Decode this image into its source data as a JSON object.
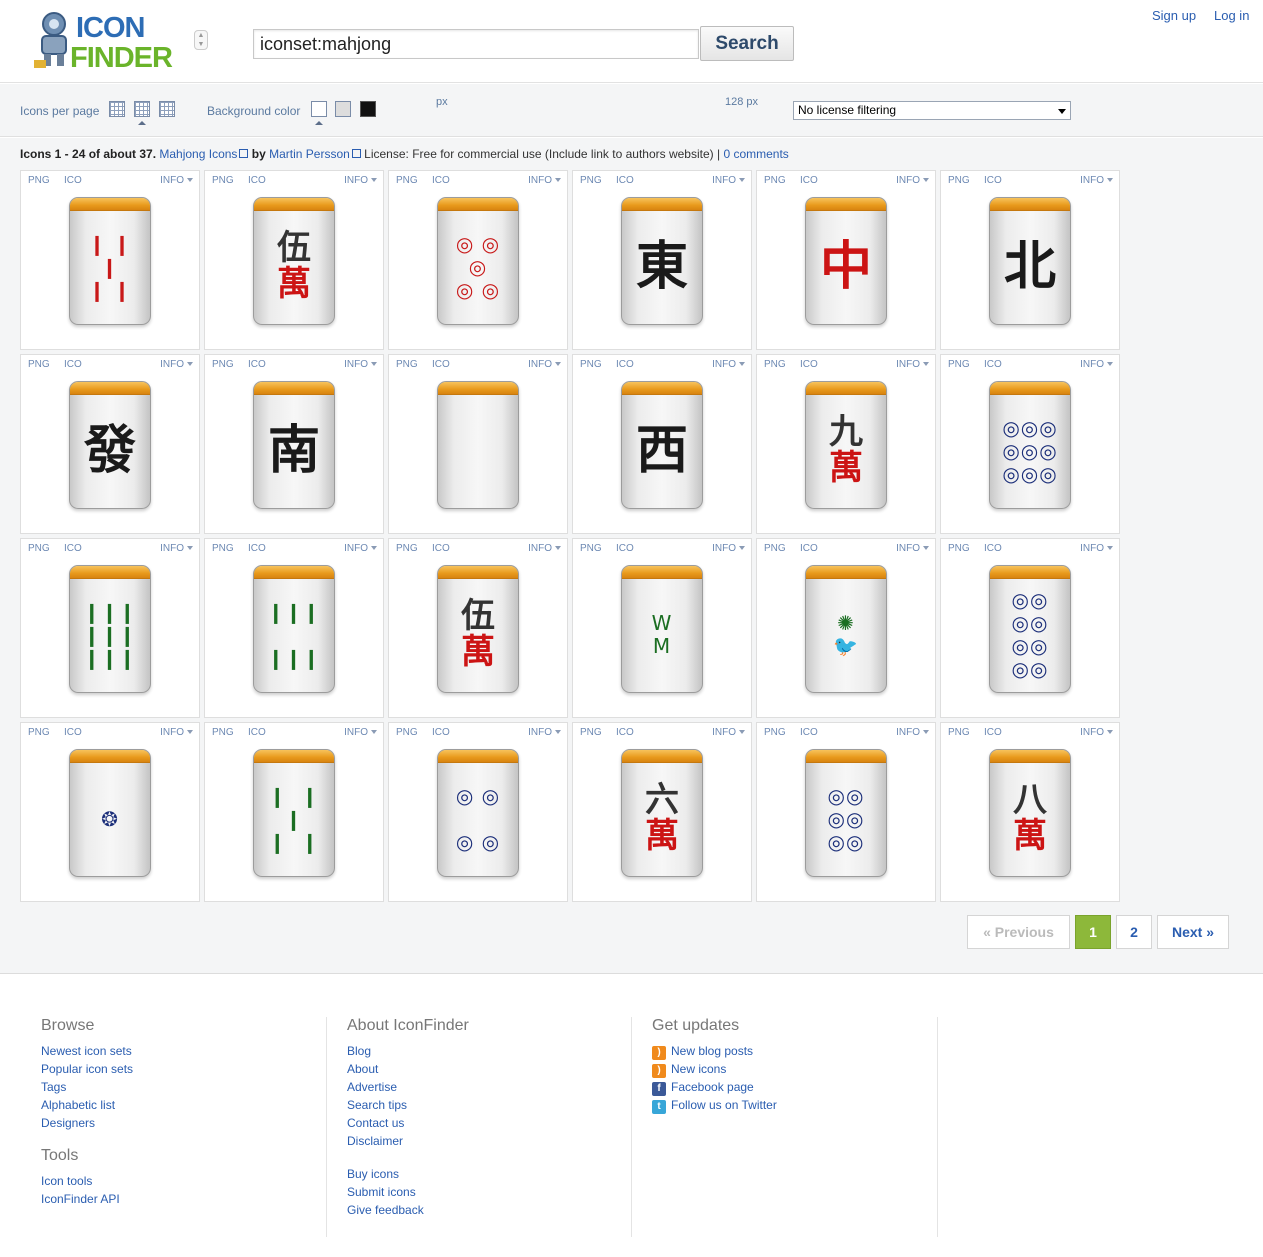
{
  "header": {
    "logo_top": "ICON",
    "logo_bottom": "FINDER",
    "search_value": "iconset:mahjong",
    "search_button": "Search",
    "signup": "Sign up",
    "login": "Log in"
  },
  "toolbar": {
    "icons_per_page_label": "Icons per page",
    "background_color_label": "Background color",
    "px_label": "px",
    "size_label": "128 px",
    "license_filter": "No license filtering"
  },
  "results": {
    "range": "Icons 1 - 24 of about 37.",
    "set_name": "Mahjong Icons",
    "by": "by",
    "author": "Martin Persson",
    "license": "License: Free for commercial use (Include link to authors website) |",
    "comments": "0 comments"
  },
  "cell_labels": {
    "png": "PNG",
    "ico": "ICO",
    "info": "INFO"
  },
  "icons": [
    {
      "name": "bamboo-5",
      "kind": "sym",
      "color": "c-red",
      "text": "❙ ❙\n ❙ \n❙ ❙"
    },
    {
      "name": "character-5",
      "kind": "pair",
      "top": "伍",
      "bottom": "萬"
    },
    {
      "name": "circle-5",
      "kind": "sym",
      "color": "c-red",
      "text": "◎ ◎\n ◎ \n◎ ◎"
    },
    {
      "name": "wind-east",
      "kind": "char",
      "char": "東"
    },
    {
      "name": "dragon-red",
      "kind": "red",
      "char": "中"
    },
    {
      "name": "wind-north",
      "kind": "char",
      "char": "北"
    },
    {
      "name": "dragon-green",
      "kind": "char",
      "char": "發"
    },
    {
      "name": "wind-south",
      "kind": "char",
      "char": "南"
    },
    {
      "name": "dragon-white",
      "kind": "blank"
    },
    {
      "name": "wind-west",
      "kind": "char",
      "char": "西"
    },
    {
      "name": "character-9",
      "kind": "pair",
      "top": "九",
      "bottom": "萬"
    },
    {
      "name": "circle-9",
      "kind": "sym",
      "color": "c-blue",
      "text": "◎◎◎\n◎◎◎\n◎◎◎"
    },
    {
      "name": "bamboo-9",
      "kind": "sym",
      "color": "c-green",
      "text": "❙❙❙\n❙❙❙\n❙❙❙"
    },
    {
      "name": "bamboo-6",
      "kind": "sym",
      "color": "c-green",
      "text": "❙❙❙\n\n❙❙❙"
    },
    {
      "name": "character-5-alt",
      "kind": "pair",
      "top": "伍",
      "bottom": "萬"
    },
    {
      "name": "bamboo-8",
      "kind": "sym",
      "color": "c-green",
      "text": "W\nM"
    },
    {
      "name": "bamboo-1",
      "kind": "sym",
      "color": "c-green",
      "text": "✺\n🐦"
    },
    {
      "name": "circle-8",
      "kind": "sym",
      "color": "c-blue",
      "text": "◎◎\n◎◎\n◎◎\n◎◎"
    },
    {
      "name": "circle-1",
      "kind": "sym",
      "color": "c-blue",
      "text": "❂"
    },
    {
      "name": "bamboo-4",
      "kind": "sym",
      "color": "c-green",
      "text": "❙  ❙\n ❙ \n❙  ❙"
    },
    {
      "name": "circle-4",
      "kind": "sym",
      "color": "c-blue",
      "text": "◎ ◎\n\n◎ ◎"
    },
    {
      "name": "character-6",
      "kind": "pair",
      "top": "六",
      "bottom": "萬"
    },
    {
      "name": "circle-6",
      "kind": "sym",
      "color": "c-blue",
      "text": "◎◎\n◎◎\n◎◎"
    },
    {
      "name": "character-8",
      "kind": "pair",
      "top": "八",
      "bottom": "萬"
    }
  ],
  "pagination": {
    "previous": "« Previous",
    "current": "1",
    "page2": "2",
    "next": "Next »"
  },
  "footer": {
    "browse": {
      "title": "Browse",
      "links": [
        "Newest icon sets",
        "Popular icon sets",
        "Tags",
        "Alphabetic list",
        "Designers"
      ]
    },
    "tools": {
      "title": "Tools",
      "links": [
        "Icon tools",
        "IconFinder API"
      ]
    },
    "about": {
      "title": "About IconFinder",
      "links": [
        "Blog",
        "About",
        "Advertise",
        "Search tips",
        "Contact us",
        "Disclaimer"
      ],
      "links2": [
        "Buy icons",
        "Submit icons",
        "Give feedback"
      ]
    },
    "updates": {
      "title": "Get updates",
      "links": [
        {
          "icon": "rss-icon",
          "label": "New blog posts"
        },
        {
          "icon": "rss-icon",
          "label": "New icons"
        },
        {
          "icon": "facebook-icon",
          "label": "Facebook page"
        },
        {
          "icon": "twitter-icon",
          "label": "Follow us on Twitter"
        }
      ]
    }
  }
}
